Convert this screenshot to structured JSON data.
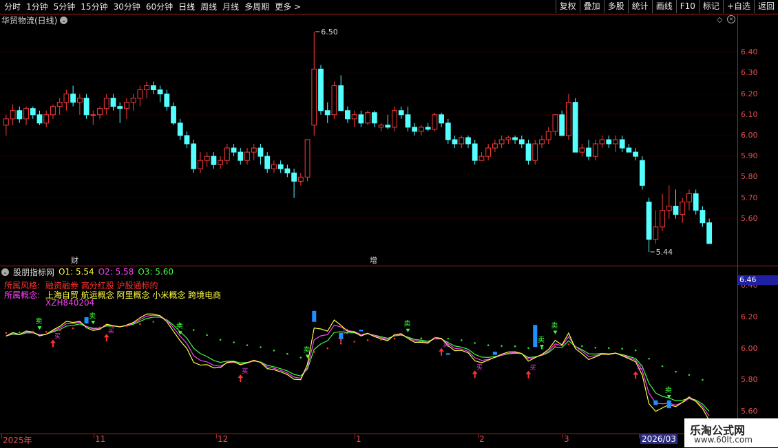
{
  "toolbar": {
    "periods": [
      "分时",
      "1分钟",
      "5分钟",
      "15分钟",
      "30分钟",
      "60分钟",
      "日线",
      "周线",
      "月线",
      "多周期",
      "更多 >"
    ],
    "active_period": "日线",
    "actions": [
      "复权",
      "叠加",
      "多股",
      "统计",
      "画线",
      "F10",
      "标记",
      "+自选",
      "返回"
    ]
  },
  "header": {
    "title": "华贸物流(日线)"
  },
  "price_axis": {
    "labels": [
      "6.40",
      "6.30",
      "6.20",
      "6.10",
      "6.00",
      "5.90",
      "5.80",
      "5.70",
      "5.60"
    ],
    "high_label": "6.50",
    "low_label": "5.44"
  },
  "markers": {
    "cai": "财",
    "zeng": "增"
  },
  "indicator": {
    "name": "股朋指标网",
    "o1": "O1: 5.54",
    "o2": "O2: 5.58",
    "o3": "O3: 5.60",
    "style_label": "所属风格:",
    "style_value": "融资融券 高分红股 沪股通标的",
    "concept_label": "所属概念:",
    "concept_value": "上海自贸 航运概念 阿里概念 小米概念 跨境电商",
    "code": "XZH840204",
    "axis_labels": [
      "6.40",
      "6.20",
      "6.00",
      "5.80",
      "5.60"
    ],
    "current_price": "6.46",
    "sell_char": "卖",
    "buy_char": "买"
  },
  "date_axis": {
    "labels": [
      "2025年",
      "11",
      "12",
      "1",
      "2",
      "3",
      "2026/03"
    ]
  },
  "watermark": {
    "title": "乐淘公式网",
    "url": "www.60lt.com"
  },
  "colors": {
    "up": "#ff3b3b",
    "down": "#54ffff",
    "axis": "#b02020",
    "ma": "#ffff00",
    "dot_green": "#33dd33",
    "dot_red": "#ff3333"
  },
  "chart_data": {
    "type": "candlestick",
    "ylim": [
      5.44,
      6.5
    ],
    "candles_ohlc": [
      [
        6.05,
        6.1,
        6.0,
        6.08
      ],
      [
        6.08,
        6.15,
        6.05,
        6.12
      ],
      [
        6.12,
        6.14,
        6.06,
        6.08
      ],
      [
        6.08,
        6.14,
        6.05,
        6.13
      ],
      [
        6.13,
        6.14,
        6.08,
        6.1
      ],
      [
        6.1,
        6.12,
        6.05,
        6.06
      ],
      [
        6.06,
        6.12,
        6.04,
        6.1
      ],
      [
        6.1,
        6.15,
        6.08,
        6.14
      ],
      [
        6.14,
        6.18,
        6.1,
        6.16
      ],
      [
        6.16,
        6.22,
        6.12,
        6.2
      ],
      [
        6.2,
        6.24,
        6.14,
        6.16
      ],
      [
        6.16,
        6.2,
        6.1,
        6.18
      ],
      [
        6.18,
        6.2,
        6.08,
        6.1
      ],
      [
        6.1,
        6.12,
        6.05,
        6.1
      ],
      [
        6.1,
        6.14,
        6.08,
        6.13
      ],
      [
        6.13,
        6.2,
        6.1,
        6.18
      ],
      [
        6.18,
        6.2,
        6.12,
        6.14
      ],
      [
        6.14,
        6.16,
        6.06,
        6.13
      ],
      [
        6.13,
        6.18,
        6.08,
        6.16
      ],
      [
        6.16,
        6.2,
        6.12,
        6.18
      ],
      [
        6.18,
        6.24,
        6.14,
        6.22
      ],
      [
        6.22,
        6.26,
        6.18,
        6.24
      ],
      [
        6.24,
        6.26,
        6.2,
        6.22
      ],
      [
        6.22,
        6.24,
        6.16,
        6.2
      ],
      [
        6.2,
        6.22,
        6.12,
        6.14
      ],
      [
        6.14,
        6.16,
        6.05,
        6.06
      ],
      [
        6.06,
        6.08,
        5.98,
        6.0
      ],
      [
        6.0,
        6.02,
        5.94,
        5.96
      ],
      [
        5.96,
        5.98,
        5.82,
        5.84
      ],
      [
        5.84,
        5.92,
        5.82,
        5.88
      ],
      [
        5.88,
        5.92,
        5.85,
        5.9
      ],
      [
        5.9,
        5.92,
        5.84,
        5.86
      ],
      [
        5.86,
        5.9,
        5.84,
        5.88
      ],
      [
        5.88,
        5.96,
        5.86,
        5.94
      ],
      [
        5.94,
        5.96,
        5.9,
        5.92
      ],
      [
        5.92,
        5.94,
        5.86,
        5.88
      ],
      [
        5.88,
        5.94,
        5.86,
        5.92
      ],
      [
        5.92,
        5.96,
        5.88,
        5.94
      ],
      [
        5.94,
        5.96,
        5.86,
        5.9
      ],
      [
        5.9,
        5.92,
        5.82,
        5.84
      ],
      [
        5.84,
        5.88,
        5.82,
        5.86
      ],
      [
        5.86,
        5.88,
        5.82,
        5.84
      ],
      [
        5.84,
        5.86,
        5.8,
        5.82
      ],
      [
        5.82,
        5.84,
        5.7,
        5.78
      ],
      [
        5.78,
        5.82,
        5.76,
        5.8
      ],
      [
        5.8,
        5.9,
        5.78,
        5.98
      ],
      [
        6.05,
        6.5,
        6.0,
        6.32
      ],
      [
        6.32,
        6.34,
        6.1,
        6.12
      ],
      [
        6.12,
        6.16,
        6.06,
        6.1
      ],
      [
        6.1,
        6.26,
        6.08,
        6.24
      ],
      [
        6.24,
        6.29,
        6.14,
        6.12
      ],
      [
        6.12,
        6.14,
        6.06,
        6.08
      ],
      [
        6.08,
        6.12,
        6.04,
        6.1
      ],
      [
        6.1,
        6.12,
        6.04,
        6.06
      ],
      [
        6.06,
        6.12,
        6.05,
        6.11
      ],
      [
        6.11,
        6.12,
        6.04,
        6.06
      ],
      [
        6.04,
        6.06,
        6.02,
        6.05
      ],
      [
        6.05,
        6.1,
        6.03,
        6.04
      ],
      [
        6.04,
        6.14,
        6.02,
        6.12
      ],
      [
        6.12,
        6.14,
        6.08,
        6.1
      ],
      [
        6.1,
        6.14,
        6.02,
        6.04
      ],
      [
        6.04,
        6.06,
        6.0,
        6.02
      ],
      [
        6.02,
        6.05,
        6.0,
        6.04
      ],
      [
        6.04,
        6.06,
        6.02,
        6.03
      ],
      [
        6.03,
        6.11,
        6.02,
        6.1
      ],
      [
        6.1,
        6.11,
        6.04,
        6.06
      ],
      [
        6.06,
        6.08,
        5.96,
        5.98
      ],
      [
        5.98,
        6.0,
        5.94,
        5.96
      ],
      [
        5.96,
        6.0,
        5.94,
        5.99
      ],
      [
        5.99,
        6.0,
        5.94,
        5.96
      ],
      [
        5.96,
        5.98,
        5.86,
        5.88
      ],
      [
        5.88,
        5.92,
        5.88,
        5.9
      ],
      [
        5.9,
        5.96,
        5.88,
        5.94
      ],
      [
        5.94,
        5.98,
        5.92,
        5.96
      ],
      [
        5.96,
        6.0,
        5.94,
        5.98
      ],
      [
        5.98,
        6.0,
        5.96,
        5.99
      ],
      [
        5.99,
        6.0,
        5.96,
        5.98
      ],
      [
        5.98,
        6.0,
        5.94,
        5.96
      ],
      [
        5.96,
        5.98,
        5.86,
        5.88
      ],
      [
        5.88,
        5.98,
        5.86,
        5.96
      ],
      [
        5.96,
        6.0,
        5.94,
        5.98
      ],
      [
        5.98,
        6.04,
        5.96,
        6.02
      ],
      [
        6.02,
        6.1,
        6.0,
        6.1
      ],
      [
        6.1,
        6.12,
        6.0,
        6.0
      ],
      [
        6.0,
        6.2,
        5.98,
        6.16
      ],
      [
        6.16,
        6.18,
        5.92,
        5.92
      ],
      [
        5.92,
        5.96,
        5.9,
        5.94
      ],
      [
        5.94,
        5.98,
        5.88,
        5.9
      ],
      [
        5.9,
        5.98,
        5.88,
        5.96
      ],
      [
        5.96,
        6.0,
        5.94,
        5.98
      ],
      [
        5.98,
        6.0,
        5.94,
        5.96
      ],
      [
        5.96,
        6.0,
        5.92,
        5.98
      ],
      [
        5.98,
        6.0,
        5.92,
        5.94
      ],
      [
        5.94,
        5.96,
        5.92,
        5.92
      ],
      [
        5.92,
        5.94,
        5.88,
        5.9
      ],
      [
        5.88,
        5.9,
        5.74,
        5.76
      ],
      [
        5.68,
        5.7,
        5.44,
        5.5
      ],
      [
        5.5,
        5.64,
        5.48,
        5.56
      ],
      [
        5.56,
        5.72,
        5.54,
        5.64
      ],
      [
        5.64,
        5.76,
        5.6,
        5.66
      ],
      [
        5.66,
        5.74,
        5.6,
        5.62
      ],
      [
        5.62,
        5.7,
        5.58,
        5.68
      ],
      [
        5.68,
        5.74,
        5.64,
        5.72
      ],
      [
        5.72,
        5.74,
        5.62,
        5.64
      ],
      [
        5.64,
        5.66,
        5.56,
        5.58
      ],
      [
        5.58,
        5.6,
        5.48,
        5.48
      ]
    ]
  }
}
